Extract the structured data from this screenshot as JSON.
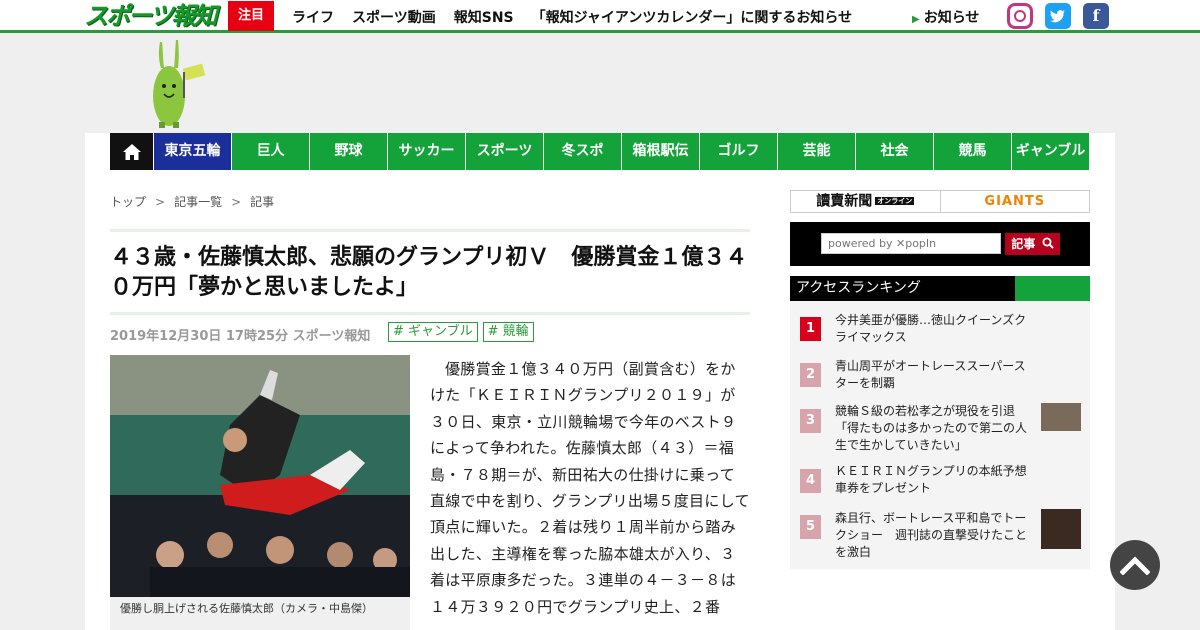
{
  "header": {
    "logo": "スポーツ報知",
    "attention_label": "注目",
    "nav": [
      "ライフ",
      "スポーツ動画",
      "報知SNS",
      "「報知ジャイアンツカレンダー」に関するお知らせ"
    ],
    "oshirase": "お知らせ",
    "social": [
      "instagram-icon",
      "twitter-icon",
      "facebook-icon"
    ]
  },
  "mainnav": {
    "items": [
      "東京五輪",
      "巨人",
      "野球",
      "サッカー",
      "スポーツ",
      "冬スポ",
      "箱根駅伝",
      "ゴルフ",
      "芸能",
      "社会",
      "競馬",
      "ギャンブル"
    ]
  },
  "breadcrumb": [
    "トップ",
    "記事一覧",
    "記事"
  ],
  "breadcrumb_sep": ">",
  "article": {
    "title": "４３歳・佐藤慎太郎、悲願のグランプリ初Ｖ　優勝賞金１億３４０万円「夢かと思いましたよ」",
    "date": "2019年12月30日 17時25分",
    "source": "スポーツ報知",
    "tags": [
      "# ギャンブル",
      "# 競輪"
    ],
    "caption": "優勝し胴上げされる佐藤慎太郎（カメラ・中島傑）",
    "body": "優勝賞金１億３４０万円（副賞含む）をかけた「ＫＥＩＲＩＮグランプリ２０１９」が３０日、東京・立川競輪場で今年のベスト９によって争われた。佐藤慎太郎（４３）＝福島・７８期＝が、新田祐大の仕掛けに乗って直線で中を割り、グランプリ出場５度目にして頂点に輝いた。２着は残り１周半前から踏み出した、主導権を奪った脇本雄太が入り、３着は平原康多だった。３連単の４－３－８は１４万３９２０円でグランプリ史上、２番"
  },
  "sidebar": {
    "banner_left": "讀賣新聞",
    "banner_left_sub": "オンライン",
    "banner_right": "GIANTS",
    "search_placeholder": "powered by ✕popIn",
    "search_button": "記事",
    "ranking_title": "アクセスランキング",
    "ranking": [
      {
        "num": "1",
        "text": "今井美亜が優勝…徳山クイーンズクライマックス",
        "thumb": false
      },
      {
        "num": "2",
        "text": "青山周平がオートレーススーパースターを制覇",
        "thumb": false
      },
      {
        "num": "3",
        "text": "競輪Ｓ級の若松孝之が現役を引退「得たものは多かったので第二の人生で生かしていきたい」",
        "thumb": true
      },
      {
        "num": "4",
        "text": "ＫＥＩＲＩＮグランプリの本紙予想車券をプレゼント",
        "thumb": false
      },
      {
        "num": "5",
        "text": "森且行、ボートレース平和島でトークショー　週刊誌の直撃受けたことを激白",
        "thumb": true
      }
    ]
  },
  "colors": {
    "brand_green": "#13a33a",
    "olympic_blue": "#1a2f9a",
    "attention_red": "#e60012",
    "rank1": "#d6001c",
    "rank_other": "#d7a4ab"
  }
}
